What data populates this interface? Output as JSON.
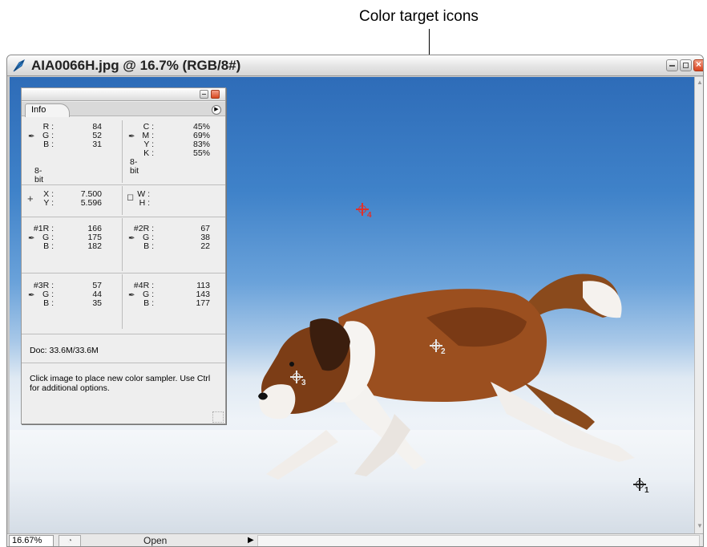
{
  "callout": {
    "text": "Color target icons"
  },
  "window": {
    "title": "AIA0066H.jpg @ 16.7% (RGB/8#)",
    "buttons": {
      "minimize": "minimize",
      "maximize": "maximize",
      "close": "×"
    }
  },
  "info_panel": {
    "tab_label": "Info",
    "rgb": {
      "r_label": "R :",
      "r": "84",
      "g_label": "G :",
      "g": "52",
      "b_label": "B :",
      "b": "31",
      "bit": "8-bit"
    },
    "cmyk": {
      "c_label": "C :",
      "c": "45%",
      "m_label": "M :",
      "m": "69%",
      "y_label": "Y :",
      "y": "83%",
      "k_label": "K :",
      "k": "55%",
      "bit": "8-bit"
    },
    "position": {
      "x_label": "X :",
      "x": "7.500",
      "y_label": "Y :",
      "y": "5.596",
      "w_label": "W :",
      "h_label": "H :"
    },
    "samplers": [
      {
        "r_label": "#1R :",
        "r": "166",
        "g_label": "G :",
        "g": "175",
        "b_label": "B :",
        "b": "182"
      },
      {
        "r_label": "#2R :",
        "r": "67",
        "g_label": "G :",
        "g": "38",
        "b_label": "B :",
        "b": "22"
      },
      {
        "r_label": "#3R :",
        "r": "57",
        "g_label": "G :",
        "g": "44",
        "b_label": "B :",
        "b": "35"
      },
      {
        "r_label": "#4R :",
        "r": "113",
        "g_label": "G :",
        "g": "143",
        "b_label": "B :",
        "b": "177"
      }
    ],
    "doc": "Doc: 33.6M/33.6M",
    "help": "Click image to place new color sampler. Use Ctrl for additional options."
  },
  "markers": [
    {
      "number": "1",
      "color": "#222222"
    },
    {
      "number": "2",
      "color": "#e8e8e8"
    },
    {
      "number": "3",
      "color": "#e8e8e8"
    },
    {
      "number": "4",
      "color": "#e0302a"
    }
  ],
  "statusbar": {
    "zoom": "16.67%",
    "status": "Open"
  },
  "colors": {
    "sky_top": "#2e6cb8",
    "snow": "#eef3f8",
    "close_red": "#d9421d"
  }
}
